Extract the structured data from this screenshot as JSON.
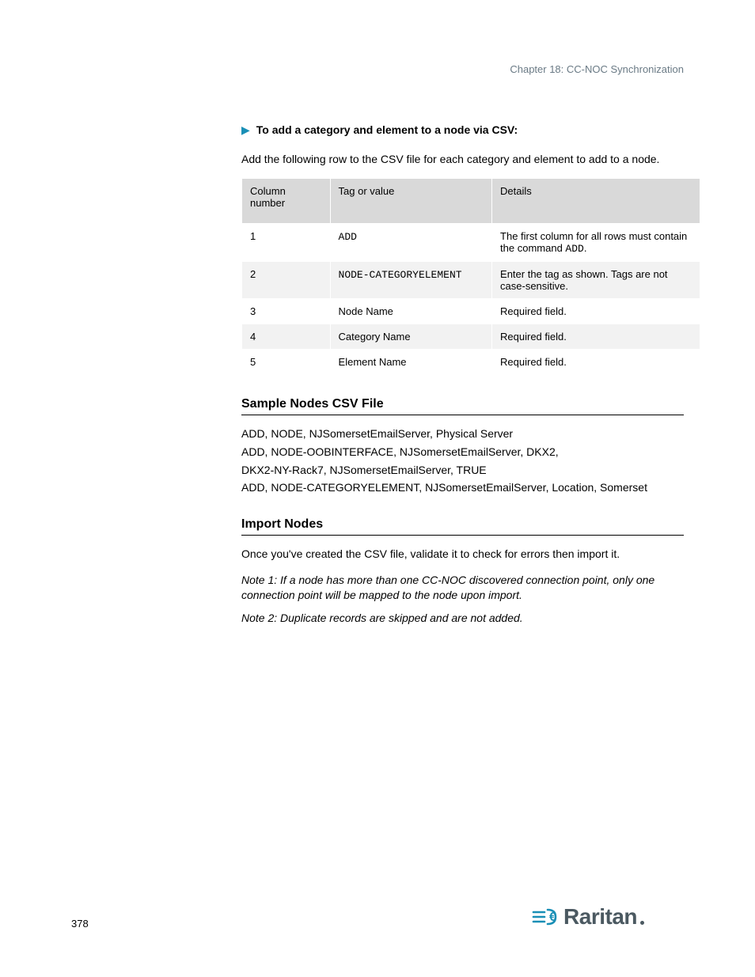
{
  "chapter_ref": "Chapter 18: CC-NOC Synchronization",
  "task": {
    "prefix": "To add a category and element to a node via CSV:",
    "intro": "Add the following row to the CSV file for each category and element to add to a node."
  },
  "table": {
    "headers": [
      "Column number",
      "Tag or value",
      "Details"
    ],
    "rows": [
      {
        "c0": "1",
        "c1_code": "ADD",
        "c1_rest": "",
        "c2": "The first column for all rows must contain the command ADD.",
        "c2_code": "ADD"
      },
      {
        "c0": "2",
        "c1_code": "NODE-CATEGORYELEMENT",
        "c1_rest": "",
        "c2": "Enter the tag as shown. Tags are not case-sensitive."
      },
      {
        "c0": "3",
        "c1_code": "",
        "c1_rest": "Node Name",
        "c2": "Required field."
      },
      {
        "c0": "4",
        "c1_code": "",
        "c1_rest": "Category Name",
        "c2": "Required field."
      },
      {
        "c0": "5",
        "c1_code": "",
        "c1_rest": "Element Name",
        "c2": "Required field."
      }
    ]
  },
  "sections": {
    "sample": {
      "title": "Sample Nodes CSV File",
      "lines": [
        "ADD, NODE, NJSomersetEmailServer, Physical Server",
        "ADD, NODE-OOBINTERFACE, NJSomersetEmailServer, DKX2,",
        "DKX2-NY-Rack7, NJSomersetEmailServer, TRUE",
        "ADD, NODE-CATEGORYELEMENT, NJSomersetEmailServer, Location, Somerset"
      ]
    },
    "import": {
      "title": "Import Nodes",
      "body": "Once you've created the CSV file, validate it to check for errors then import it.",
      "note1": "Note 1: If a node has more than one CC-NOC discovered connection point, only one connection point will be mapped to the node upon import.",
      "note2": "Note 2: Duplicate records are skipped and are not added."
    }
  },
  "page_number": "378",
  "brand": "Raritan"
}
